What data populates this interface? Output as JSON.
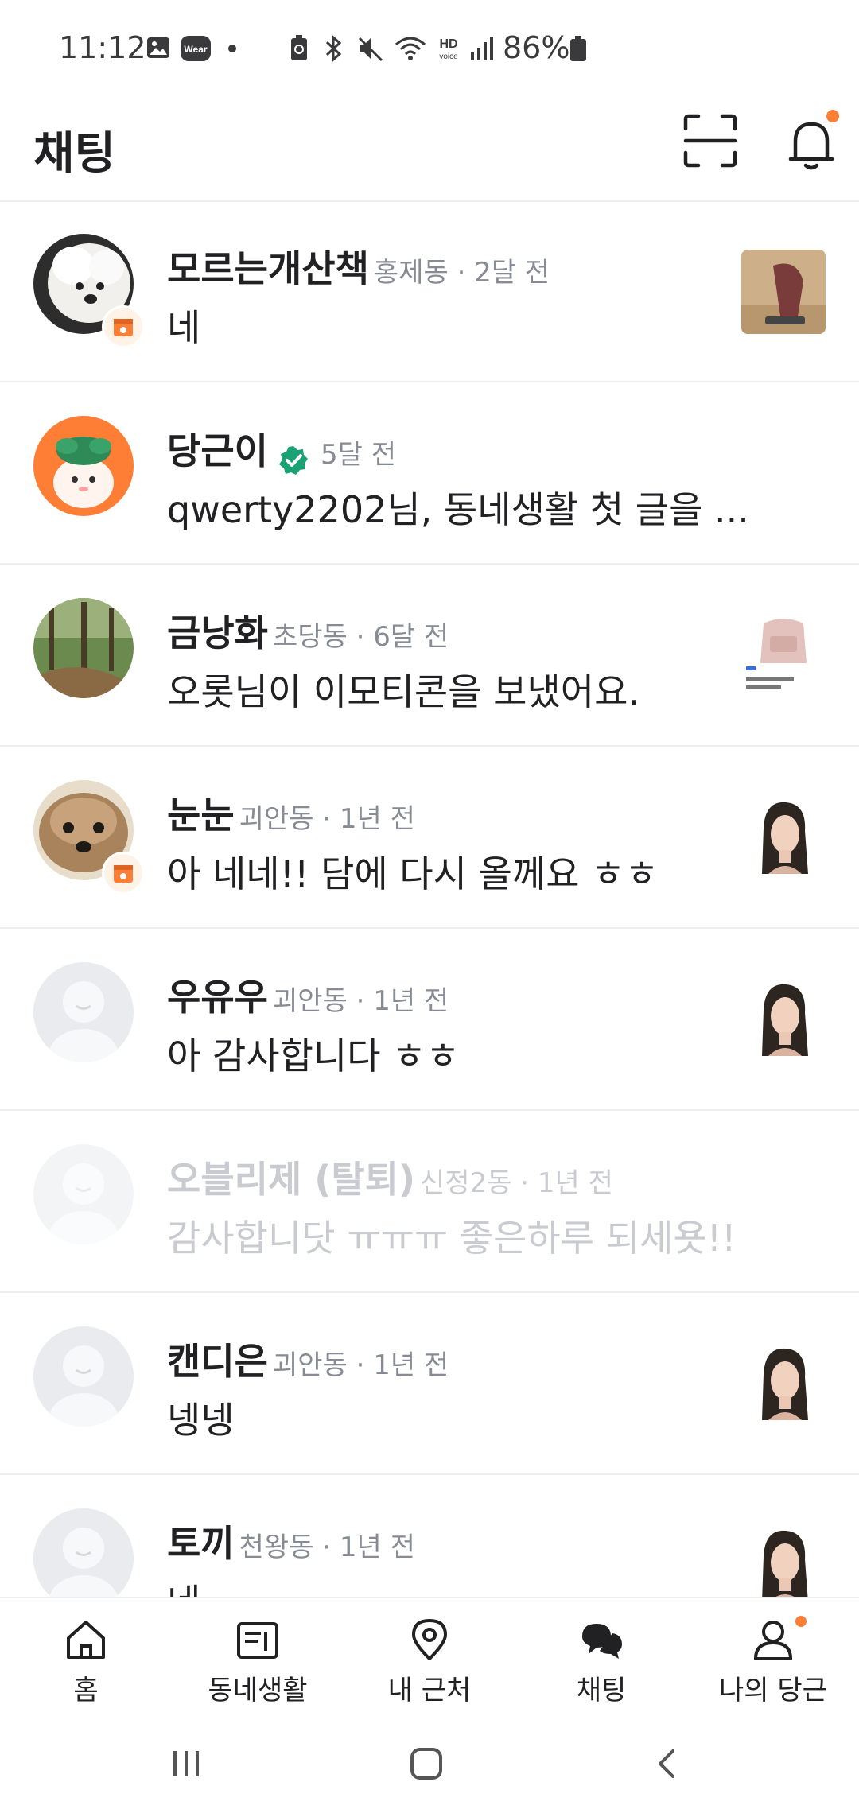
{
  "status_bar": {
    "time": "11:12",
    "battery": "86%",
    "icons": [
      "gallery-icon",
      "wear-icon",
      "dot-icon",
      "battery-saver-icon",
      "bluetooth-icon",
      "mute-icon",
      "wifi-icon",
      "hd-voice-icon",
      "signal-icon",
      "battery-icon"
    ]
  },
  "header": {
    "title": "채팅",
    "icons": [
      "scan-icon",
      "bell-icon"
    ]
  },
  "chats": [
    {
      "name": "모르는개산책",
      "meta": "홍제동 · 2달 전",
      "message": "네",
      "avatar": "dog-white",
      "badge": true,
      "verified": false,
      "thumb": "product-dryer",
      "dim": false
    },
    {
      "name": "당근이",
      "meta": "5달 전",
      "message": "qwerty2202님, 동네생활 첫 글을 ...",
      "avatar": "daangni",
      "badge": false,
      "verified": true,
      "thumb": "",
      "dim": false
    },
    {
      "name": "금낭화",
      "meta": "초당동 · 6달 전",
      "message": "오롯님이 이모티콘을 보냈어요.",
      "avatar": "forest",
      "badge": false,
      "verified": false,
      "thumb": "product-bag",
      "dim": false
    },
    {
      "name": "눈눈",
      "meta": "괴안동 · 1년 전",
      "message": "아 네네!! 담에 다시 올께요 ㅎㅎ",
      "avatar": "dog-brown",
      "badge": true,
      "verified": false,
      "thumb": "portrait",
      "dim": false
    },
    {
      "name": "우유우",
      "meta": "괴안동 · 1년 전",
      "message": "아 감사합니다 ㅎㅎ",
      "avatar": "default",
      "badge": false,
      "verified": false,
      "thumb": "portrait",
      "dim": false
    },
    {
      "name": "오블리제 (탈퇴)",
      "meta": "신정2동 · 1년 전",
      "message": "감사합니닷 ㅠㅠㅠ 좋은하루 되세욧!!",
      "avatar": "default",
      "badge": false,
      "verified": false,
      "thumb": "",
      "dim": true
    },
    {
      "name": "캔디은",
      "meta": "괴안동 · 1년 전",
      "message": "넹넹",
      "avatar": "default",
      "badge": false,
      "verified": false,
      "thumb": "portrait",
      "dim": false
    },
    {
      "name": "토끼",
      "meta": "천왕동 · 1년 전",
      "message": "네",
      "avatar": "default",
      "badge": false,
      "verified": false,
      "thumb": "portrait",
      "dim": false
    }
  ],
  "bottom_nav": [
    {
      "label": "홈",
      "icon": "home-icon"
    },
    {
      "label": "동네생활",
      "icon": "community-icon"
    },
    {
      "label": "내 근처",
      "icon": "location-pin-icon"
    },
    {
      "label": "채팅",
      "icon": "chat-icon"
    },
    {
      "label": "나의 당근",
      "icon": "profile-icon"
    }
  ],
  "colors": {
    "accent": "#ff7e36",
    "verified": "#1aa174",
    "text": "#212124",
    "meta": "#868b94",
    "dim": "#c9cbd0"
  }
}
